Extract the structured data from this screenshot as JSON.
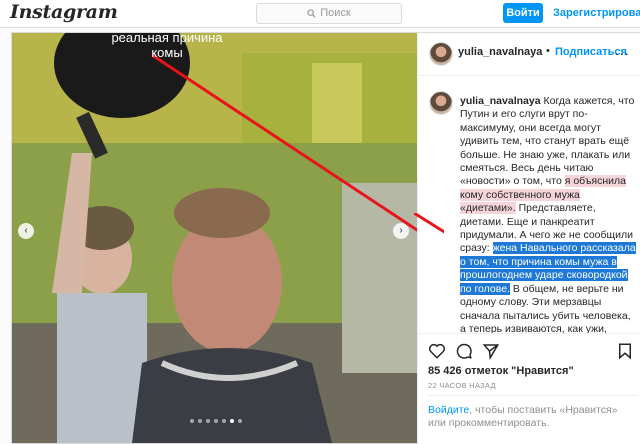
{
  "header": {
    "logo": "Instagram",
    "search_placeholder": "Поиск",
    "login_label": "Войти",
    "signup_label": "Зарегистрироваться"
  },
  "photo": {
    "overlay_text": "реальная причина комы"
  },
  "post": {
    "username": "yulia_navalnaya",
    "follow_label": "Подписаться",
    "separator": "•",
    "more": "...",
    "caption_part1": "Когда кажется, что Путин и его слуги врут по-максимуму, они всегда могут удивить тем, что станут врать ещё больше. Не знаю уже, плакать или смеяться. Весь день читаю «новости» о том, что ",
    "caption_pink": "я объяснила кому собственного мужа «диетами».",
    "caption_part2": " Представляете, диетами. Еще и панкреатит придумали. А чего же не сообщили сразу: ",
    "caption_blue": "жена Навального рассказала о том, что причина комы мужа в прошлогоднем ударе сковородкой по голове.",
    "caption_part3": " В общем, не верьте ни одному слову. Эти мерзавцы сначала пытались убить человека, а теперь извиваются, как ужи, пытаясь уйти от ответственности.",
    "likes": "85 426 отметок \"Нравится\"",
    "time": "22 ЧАСОВ НАЗАД",
    "login_link": "Войдите",
    "login_rest": ", чтобы поставить «Нравится» или прокомментировать."
  },
  "colors": {
    "accent": "#0095f6",
    "annotation_arrow": "#e8141b",
    "highlight_pink": "#f6d5da",
    "highlight_blue": "#1e78d6"
  }
}
